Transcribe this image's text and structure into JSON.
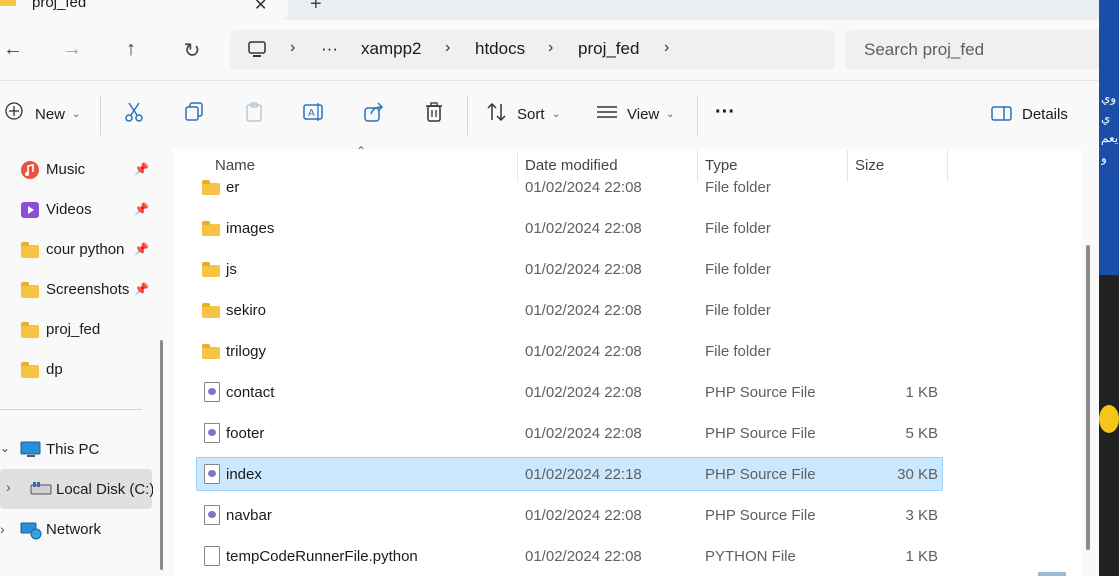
{
  "tab": {
    "title": "proj_fed",
    "close": "✕",
    "new": "+"
  },
  "nav": {
    "back": "←",
    "forward": "→",
    "up": "↑",
    "refresh": "↻"
  },
  "address": {
    "more": "···",
    "crumbs": [
      "xampp2",
      "htdocs",
      "proj_fed"
    ],
    "separator": "›"
  },
  "search": {
    "placeholder": "Search proj_fed"
  },
  "toolbar": {
    "new_label": "New",
    "sort_label": "Sort",
    "view_label": "View",
    "more_label": "···",
    "details_label": "Details",
    "caret": "⌄"
  },
  "sidebar": {
    "quick_access": [
      {
        "label": "Music",
        "icon": "music-icon",
        "pinned": true
      },
      {
        "label": "Videos",
        "icon": "videos-icon",
        "pinned": true
      },
      {
        "label": "cour python",
        "icon": "folder-icon",
        "pinned": true
      },
      {
        "label": "Screenshots",
        "icon": "folder-icon",
        "pinned": true
      },
      {
        "label": "proj_fed",
        "icon": "folder-icon",
        "pinned": false
      },
      {
        "label": "dp",
        "icon": "folder-icon",
        "pinned": false
      }
    ],
    "pin_glyph": "📌",
    "this_pc": "This PC",
    "local_disk": "Local Disk (C:)",
    "network": "Network"
  },
  "columns": {
    "name": "Name",
    "date": "Date modified",
    "type": "Type",
    "size": "Size"
  },
  "files": [
    {
      "name": "er",
      "date": "01/02/2024 22:08",
      "type": "File folder",
      "size": "",
      "kind": "folder"
    },
    {
      "name": "images",
      "date": "01/02/2024 22:08",
      "type": "File folder",
      "size": "",
      "kind": "folder"
    },
    {
      "name": "js",
      "date": "01/02/2024 22:08",
      "type": "File folder",
      "size": "",
      "kind": "folder"
    },
    {
      "name": "sekiro",
      "date": "01/02/2024 22:08",
      "type": "File folder",
      "size": "",
      "kind": "folder"
    },
    {
      "name": "trilogy",
      "date": "01/02/2024 22:08",
      "type": "File folder",
      "size": "",
      "kind": "folder"
    },
    {
      "name": "contact",
      "date": "01/02/2024 22:08",
      "type": "PHP Source File",
      "size": "1 KB",
      "kind": "php"
    },
    {
      "name": "footer",
      "date": "01/02/2024 22:08",
      "type": "PHP Source File",
      "size": "5 KB",
      "kind": "php"
    },
    {
      "name": "index",
      "date": "01/02/2024 22:18",
      "type": "PHP Source File",
      "size": "30 KB",
      "kind": "php",
      "selected": true
    },
    {
      "name": "navbar",
      "date": "01/02/2024 22:08",
      "type": "PHP Source File",
      "size": "3 KB",
      "kind": "php"
    },
    {
      "name": "tempCodeRunnerFile.python",
      "date": "01/02/2024 22:08",
      "type": "PYTHON File",
      "size": "1 KB",
      "kind": "file"
    }
  ],
  "background": {
    "text": "وي ي يعم و"
  },
  "colors": {
    "selection": "#cce8ff",
    "selection_border": "#99d1ff",
    "folder": "#f6c343",
    "accent": "#0067c0"
  }
}
